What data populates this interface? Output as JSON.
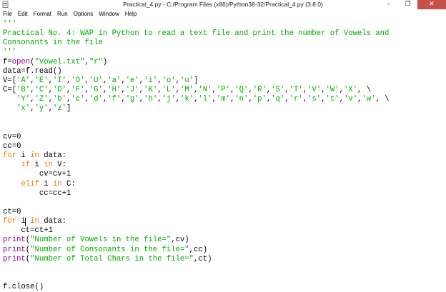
{
  "window": {
    "title": "Practical_4.py - C:/Program Files (x86)/Python38-32/Practical_4.py (3.8.0)",
    "minimize_glyph": "–",
    "maximize_glyph": "❐",
    "close_glyph": "✕",
    "icon": "python-file-icon"
  },
  "menu": {
    "items": [
      "File",
      "Edit",
      "Format",
      "Run",
      "Options",
      "Window",
      "Help"
    ]
  },
  "editor": {
    "cursor": {
      "line": 21,
      "column": 5
    },
    "colors": {
      "keyword": "#ff7700",
      "builtin": "#900090",
      "string": "#00aa00",
      "text": "#000000"
    },
    "lines": [
      [
        [
          "st",
          "'''"
        ]
      ],
      [
        [
          "st",
          "Practical No. 4: WAP in Python to read a text file and print the number of Vowels and"
        ]
      ],
      [
        [
          "st",
          "Consonants in the file"
        ]
      ],
      [
        [
          "st",
          "'''"
        ]
      ],
      [
        [
          "",
          "f="
        ],
        [
          "bi",
          "open"
        ],
        [
          "",
          "("
        ],
        [
          "st",
          "\"Vowel.txt\""
        ],
        [
          "",
          ","
        ],
        [
          "st",
          "\"r\""
        ],
        [
          "",
          ")"
        ]
      ],
      [
        [
          "",
          "data=f.read()"
        ]
      ],
      [
        [
          "",
          "V=["
        ],
        [
          "st",
          "'A'"
        ],
        [
          "",
          ","
        ],
        [
          "st",
          "'E'"
        ],
        [
          "",
          ","
        ],
        [
          "st",
          "'I'"
        ],
        [
          "",
          ","
        ],
        [
          "st",
          "'O'"
        ],
        [
          "",
          ","
        ],
        [
          "st",
          "'U'"
        ],
        [
          "",
          ","
        ],
        [
          "st",
          "'a'"
        ],
        [
          "",
          ","
        ],
        [
          "st",
          "'e'"
        ],
        [
          "",
          ","
        ],
        [
          "st",
          "'i'"
        ],
        [
          "",
          ","
        ],
        [
          "st",
          "'o'"
        ],
        [
          "",
          ","
        ],
        [
          "st",
          "'u'"
        ],
        [
          "",
          "]"
        ]
      ],
      [
        [
          "",
          "C=["
        ],
        [
          "st",
          "'B'"
        ],
        [
          "",
          ","
        ],
        [
          "st",
          "'C'"
        ],
        [
          "",
          ","
        ],
        [
          "st",
          "'D'"
        ],
        [
          "",
          ","
        ],
        [
          "st",
          "'F'"
        ],
        [
          "",
          ","
        ],
        [
          "st",
          "'G'"
        ],
        [
          "",
          ","
        ],
        [
          "st",
          "'H'"
        ],
        [
          "",
          ","
        ],
        [
          "st",
          "'J'"
        ],
        [
          "",
          ","
        ],
        [
          "st",
          "'K'"
        ],
        [
          "",
          ","
        ],
        [
          "st",
          "'L'"
        ],
        [
          "",
          ","
        ],
        [
          "st",
          "'M'"
        ],
        [
          "",
          ","
        ],
        [
          "st",
          "'N'"
        ],
        [
          "",
          ","
        ],
        [
          "st",
          "'P'"
        ],
        [
          "",
          ","
        ],
        [
          "st",
          "'Q'"
        ],
        [
          "",
          ","
        ],
        [
          "st",
          "'R'"
        ],
        [
          "",
          ","
        ],
        [
          "st",
          "'S'"
        ],
        [
          "",
          ","
        ],
        [
          "st",
          "'T'"
        ],
        [
          "",
          ","
        ],
        [
          "st",
          "'V'"
        ],
        [
          "",
          ","
        ],
        [
          "st",
          "'W'"
        ],
        [
          "",
          ","
        ],
        [
          "st",
          "'X'"
        ],
        [
          "",
          ", \\"
        ]
      ],
      [
        [
          "",
          "   "
        ],
        [
          "st",
          "'Y'"
        ],
        [
          "",
          ","
        ],
        [
          "st",
          "'Z'"
        ],
        [
          "",
          ","
        ],
        [
          "st",
          "'b'"
        ],
        [
          "",
          ","
        ],
        [
          "st",
          "'c'"
        ],
        [
          "",
          ","
        ],
        [
          "st",
          "'d'"
        ],
        [
          "",
          ","
        ],
        [
          "st",
          "'f'"
        ],
        [
          "",
          ","
        ],
        [
          "st",
          "'g'"
        ],
        [
          "",
          ","
        ],
        [
          "st",
          "'h'"
        ],
        [
          "",
          ","
        ],
        [
          "st",
          "'j'"
        ],
        [
          "",
          ","
        ],
        [
          "st",
          "'k'"
        ],
        [
          "",
          ","
        ],
        [
          "st",
          "'l'"
        ],
        [
          "",
          ","
        ],
        [
          "st",
          "'m'"
        ],
        [
          "",
          ","
        ],
        [
          "st",
          "'n'"
        ],
        [
          "",
          ","
        ],
        [
          "st",
          "'p'"
        ],
        [
          "",
          ","
        ],
        [
          "st",
          "'q'"
        ],
        [
          "",
          ","
        ],
        [
          "st",
          "'r'"
        ],
        [
          "",
          ","
        ],
        [
          "st",
          "'s'"
        ],
        [
          "",
          ","
        ],
        [
          "st",
          "'t'"
        ],
        [
          "",
          ","
        ],
        [
          "st",
          "'v'"
        ],
        [
          "",
          ","
        ],
        [
          "st",
          "'w'"
        ],
        [
          "",
          ", \\"
        ]
      ],
      [
        [
          "",
          "   "
        ],
        [
          "st",
          "'x'"
        ],
        [
          "",
          ","
        ],
        [
          "st",
          "'y'"
        ],
        [
          "",
          ","
        ],
        [
          "st",
          "'z'"
        ],
        [
          "",
          "]"
        ]
      ],
      [],
      [],
      [
        [
          "",
          "cv=0"
        ]
      ],
      [
        [
          "",
          "cc=0"
        ]
      ],
      [
        [
          "kw",
          "for"
        ],
        [
          "",
          " i "
        ],
        [
          "kw",
          "in"
        ],
        [
          "",
          " data:"
        ]
      ],
      [
        [
          "",
          "    "
        ],
        [
          "kw",
          "if"
        ],
        [
          "",
          " i "
        ],
        [
          "kw",
          "in"
        ],
        [
          "",
          " V:"
        ]
      ],
      [
        [
          "",
          "        cv=cv+1"
        ]
      ],
      [
        [
          "",
          "    "
        ],
        [
          "kw",
          "elif"
        ],
        [
          "",
          " i "
        ],
        [
          "kw",
          "in"
        ],
        [
          "",
          " C:"
        ]
      ],
      [
        [
          "",
          "        cc=cc+1"
        ]
      ],
      [],
      [
        [
          "",
          "ct=0"
        ]
      ],
      [
        [
          "kw",
          "for"
        ],
        [
          "",
          " i "
        ],
        [
          "kw",
          "in"
        ],
        [
          "",
          " data:"
        ]
      ],
      [
        [
          "",
          "    ct=ct+1"
        ]
      ],
      [
        [
          "bi",
          "print"
        ],
        [
          "",
          "("
        ],
        [
          "st",
          "\"Number of Vowels in the file=\""
        ],
        [
          "",
          ",cv)"
        ]
      ],
      [
        [
          "bi",
          "print"
        ],
        [
          "",
          "("
        ],
        [
          "st",
          "\"Number of Consonants in the file=\""
        ],
        [
          "",
          ",cc)"
        ]
      ],
      [
        [
          "bi",
          "print"
        ],
        [
          "",
          "("
        ],
        [
          "st",
          "\"Number of Total Chars in the file=\""
        ],
        [
          "",
          ",ct)"
        ]
      ],
      [],
      [],
      [
        [
          "",
          "f.close()"
        ]
      ]
    ]
  }
}
